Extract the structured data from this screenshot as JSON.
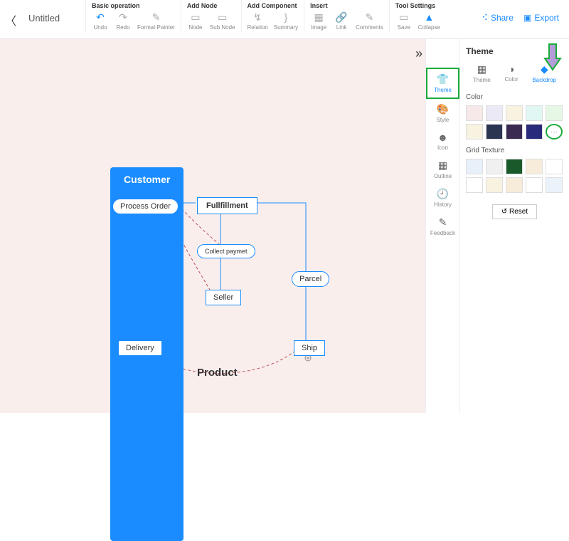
{
  "title": "Untitled",
  "toolbar": {
    "groups": [
      {
        "title": "Basic operation",
        "items": [
          {
            "name": "undo",
            "label": "Undo",
            "glyph": "↶",
            "grey": false
          },
          {
            "name": "redo",
            "label": "Redo",
            "glyph": "↷",
            "grey": true
          },
          {
            "name": "format-painter",
            "label": "Format Painter",
            "glyph": "✎",
            "grey": true
          }
        ]
      },
      {
        "title": "Add Node",
        "items": [
          {
            "name": "node",
            "label": "Node",
            "glyph": "▭",
            "grey": true
          },
          {
            "name": "sub-node",
            "label": "Sub Node",
            "glyph": "▭",
            "grey": true
          }
        ]
      },
      {
        "title": "Add Component",
        "items": [
          {
            "name": "relation",
            "label": "Relation",
            "glyph": "↯",
            "grey": true
          },
          {
            "name": "summary",
            "label": "Summary",
            "glyph": "}",
            "grey": true
          }
        ]
      },
      {
        "title": "Insert",
        "items": [
          {
            "name": "image",
            "label": "Image",
            "glyph": "▦",
            "grey": true
          },
          {
            "name": "link",
            "label": "Link",
            "glyph": "🔗",
            "grey": true
          },
          {
            "name": "comments",
            "label": "Comments",
            "glyph": "✎",
            "grey": true
          }
        ]
      },
      {
        "title": "Tool Settings",
        "items": [
          {
            "name": "save",
            "label": "Save",
            "glyph": "▭",
            "grey": true
          },
          {
            "name": "collapse",
            "label": "Collapse",
            "glyph": "▲",
            "grey": false
          }
        ]
      }
    ],
    "share": "Share",
    "export": "Export"
  },
  "side": {
    "items": [
      {
        "name": "theme",
        "label": "Theme",
        "glyph": "👕",
        "active": true
      },
      {
        "name": "style",
        "label": "Style",
        "glyph": "🎨",
        "active": false
      },
      {
        "name": "icon",
        "label": "Icon",
        "glyph": "☻",
        "active": false
      },
      {
        "name": "outline",
        "label": "Outline",
        "glyph": "▦",
        "active": false
      },
      {
        "name": "history",
        "label": "History",
        "glyph": "🕘",
        "active": false
      },
      {
        "name": "feedback",
        "label": "Feedback",
        "glyph": "✎",
        "active": false
      }
    ]
  },
  "panel": {
    "title": "Theme",
    "tabs": [
      {
        "name": "theme",
        "label": "Theme",
        "glyph": "▦"
      },
      {
        "name": "color",
        "label": "Color",
        "glyph": "◑"
      },
      {
        "name": "backdrop",
        "label": "Backdrop",
        "glyph": "◆",
        "active": true
      }
    ],
    "color_label": "Color",
    "colors_row1": [
      "#f7e9e9",
      "#ece9f7",
      "#f7f3e0",
      "#e0f7f3",
      "#e6f7e6"
    ],
    "colors_row2": [
      "#f7f3e0",
      "#2a3552",
      "#3a2a52",
      "#2a2a7a"
    ],
    "more_label": "···",
    "grid_label": "Grid Texture",
    "grids": [
      "#e8f0fa",
      "#f0f0f0",
      "#1a5a2a",
      "#f7ecd9",
      "#ffffff",
      "#ffffff",
      "#f7f3e0",
      "#f7ecd9",
      "#ffffff",
      "#eaf2fa"
    ],
    "reset_label": "Reset"
  },
  "diagram": {
    "nodes": {
      "customer": "Customer",
      "process_order": "Process Order",
      "fullfillment": "Fullfillment",
      "collect_paymet": "Collect paymet",
      "seller": "Seller",
      "parcel": "Parcel",
      "delivery": "Delivery",
      "ship": "Ship"
    },
    "label": "Product"
  }
}
